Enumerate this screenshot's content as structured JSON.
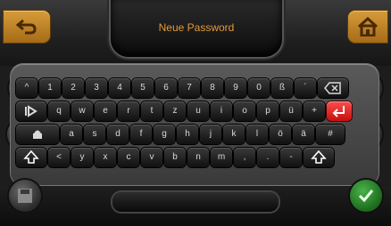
{
  "header": {
    "title": "Neue Password"
  },
  "keyboard": {
    "row1": [
      "^",
      "1",
      "2",
      "3",
      "4",
      "5",
      "6",
      "7",
      "8",
      "9",
      "0",
      "ß",
      "´"
    ],
    "row2": [
      "q",
      "w",
      "e",
      "r",
      "t",
      "z",
      "u",
      "i",
      "o",
      "p",
      "ü",
      "+"
    ],
    "row3": [
      "a",
      "s",
      "d",
      "f",
      "g",
      "h",
      "j",
      "k",
      "l",
      "ö",
      "ä",
      "#"
    ],
    "row4": [
      "<",
      "y",
      "x",
      "c",
      "v",
      "b",
      "n",
      "m",
      ",",
      ".",
      "-"
    ],
    "special": {
      "tab_label": "",
      "caps_label": "",
      "shift_label": ""
    }
  },
  "colors": {
    "accent_orange": "#e39a3c",
    "enter_red": "#e21b1b",
    "confirm_green": "#2f9a2e"
  }
}
